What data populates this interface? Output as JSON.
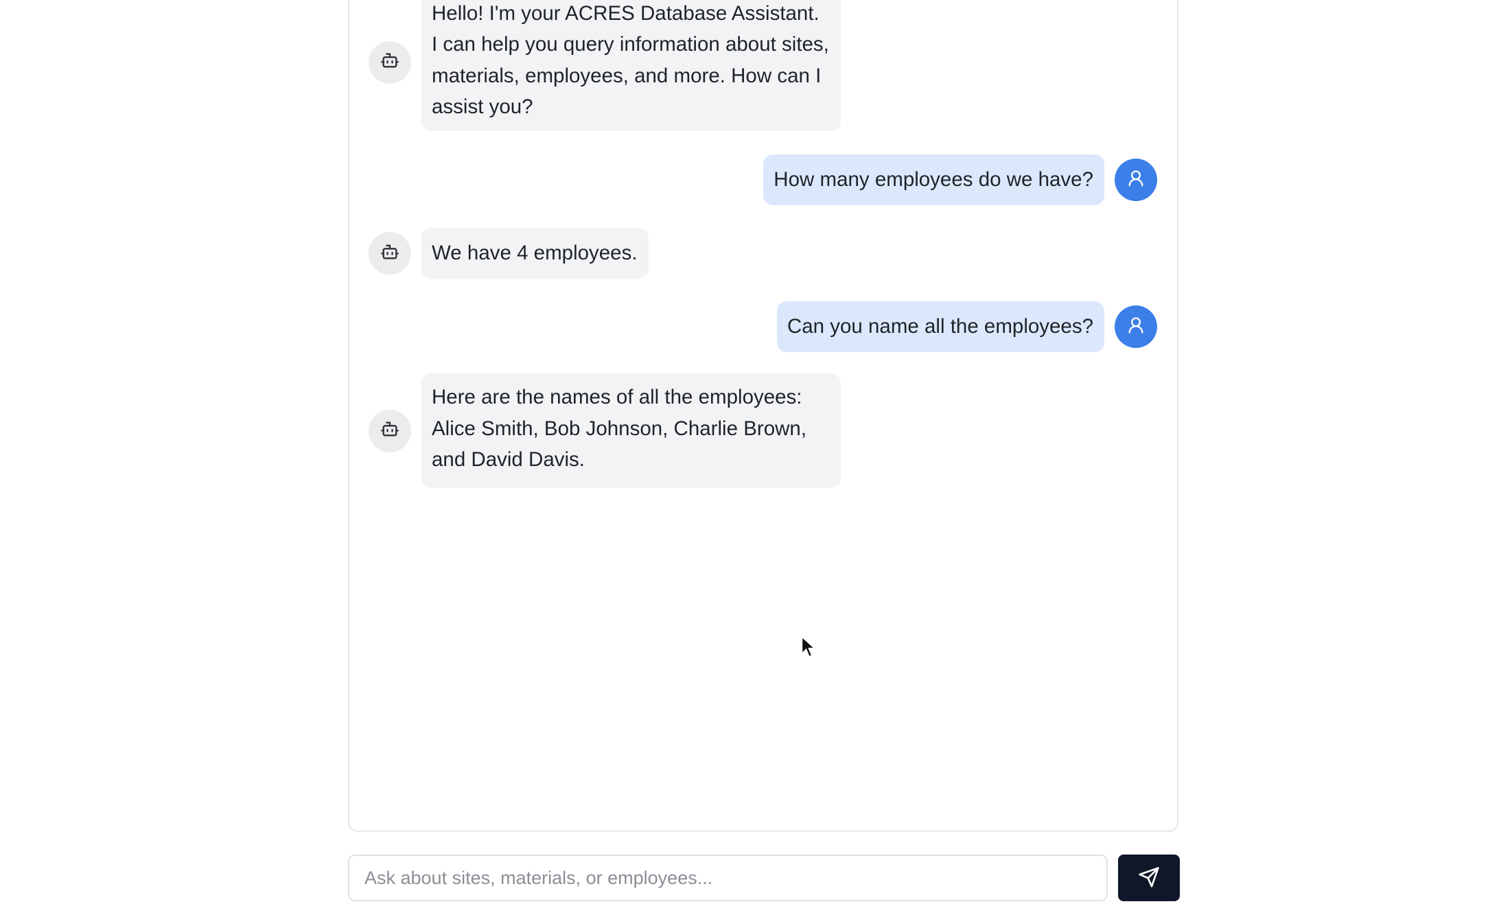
{
  "messages": [
    {
      "role": "assistant",
      "text": "Hello! I'm your ACRES Database Assistant. I can help you query information about sites, materials, employees, and more. How can I assist you?",
      "avatar_icon": "bot-icon"
    },
    {
      "role": "user",
      "text": "How many employees do we have?",
      "avatar_icon": "user-icon"
    },
    {
      "role": "assistant",
      "text": "We have 4 employees.",
      "avatar_icon": "bot-icon"
    },
    {
      "role": "user",
      "text": "Can you name all the employees?",
      "avatar_icon": "user-icon"
    },
    {
      "role": "assistant",
      "text": "Here are the names of all the employees: Alice Smith, Bob Johnson, Charlie Brown, and David Davis.",
      "avatar_icon": "bot-icon"
    }
  ],
  "composer": {
    "placeholder": "Ask about sites, materials, or employees...",
    "value": "",
    "send_icon": "send-icon"
  },
  "colors": {
    "user_avatar": "#3d7fe8",
    "user_bubble": "#dbe8fc",
    "bot_bubble": "#f2f3f5",
    "send_button": "#0f1729"
  }
}
